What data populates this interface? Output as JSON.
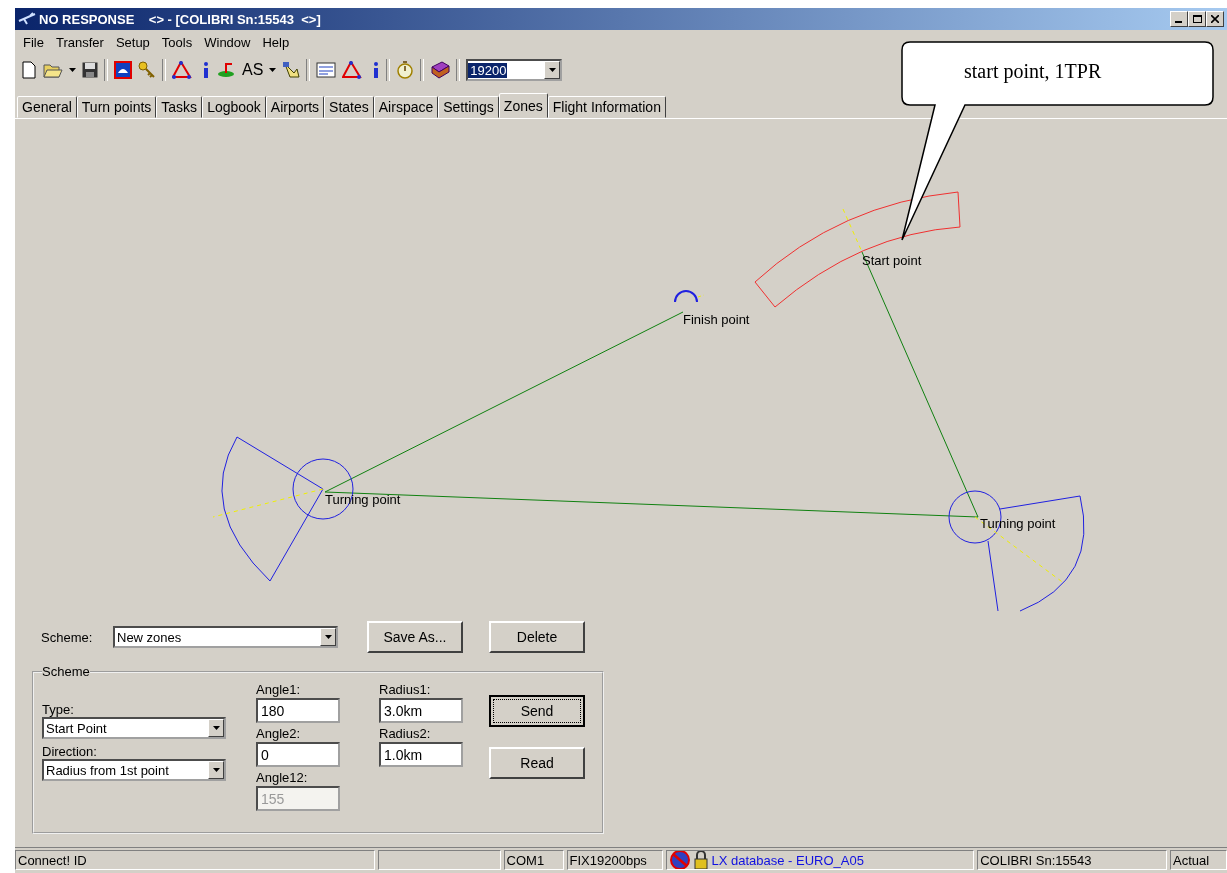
{
  "window": {
    "title": "NO RESPONSE    <> - [COLIBRI Sn:15543  <>]"
  },
  "menu": [
    {
      "label": "File"
    },
    {
      "label": "Transfer"
    },
    {
      "label": "Setup"
    },
    {
      "label": "Tools"
    },
    {
      "label": "Window"
    },
    {
      "label": "Help"
    }
  ],
  "toolbar": {
    "as_label": "AS",
    "baud_combo": {
      "value": "19200",
      "selected": true
    }
  },
  "tabs": [
    {
      "label": "General",
      "selected": false
    },
    {
      "label": "Turn points",
      "selected": false
    },
    {
      "label": "Tasks",
      "selected": false
    },
    {
      "label": "Logbook",
      "selected": false
    },
    {
      "label": "Airports",
      "selected": false
    },
    {
      "label": "States",
      "selected": false
    },
    {
      "label": "Airspace",
      "selected": false
    },
    {
      "label": "Settings",
      "selected": false
    },
    {
      "label": "Zones",
      "selected": true
    },
    {
      "label": "Flight Information",
      "selected": false
    }
  ],
  "canvas": {
    "points": [
      {
        "label": "Start point",
        "kind": "start"
      },
      {
        "label": "Finish point",
        "kind": "finish"
      },
      {
        "label": "Turning point",
        "kind": "turn"
      },
      {
        "label": "Turning point",
        "kind": "turn"
      }
    ]
  },
  "callout": {
    "text": "start point, 1TPR"
  },
  "scheme_bar": {
    "label": "Scheme:",
    "value": "New zones",
    "buttons": [
      "Save As...",
      "Delete"
    ]
  },
  "scheme_group": {
    "title": "Scheme",
    "type": {
      "label": "Type:",
      "value": "Start Point"
    },
    "direction": {
      "label": "Direction:",
      "value": "Radius from 1st point"
    },
    "angles": [
      {
        "label": "Angle1:",
        "value": "180",
        "disabled": false
      },
      {
        "label": "Angle2:",
        "value": "0",
        "disabled": false
      },
      {
        "label": "Angle12:",
        "value": "155",
        "disabled": true
      }
    ],
    "radii": [
      {
        "label": "Radius1:",
        "value": "3.0km",
        "disabled": false
      },
      {
        "label": "Radius2:",
        "value": "1.0km",
        "disabled": false
      }
    ],
    "buttons": [
      {
        "label": "Send",
        "focused": true
      },
      {
        "label": "Read",
        "focused": false
      }
    ]
  },
  "status_bar": {
    "panels": [
      {
        "kind": "text",
        "text": "Connect! ID"
      },
      {
        "kind": "blank"
      },
      {
        "kind": "text",
        "text": "COM1"
      },
      {
        "kind": "text",
        "text": "FIX19200bps"
      },
      {
        "kind": "database",
        "text": "LX database - EURO_A05"
      },
      {
        "kind": "text",
        "text": "COLIBRI Sn:15543"
      },
      {
        "kind": "text",
        "text": "Actual"
      }
    ]
  }
}
